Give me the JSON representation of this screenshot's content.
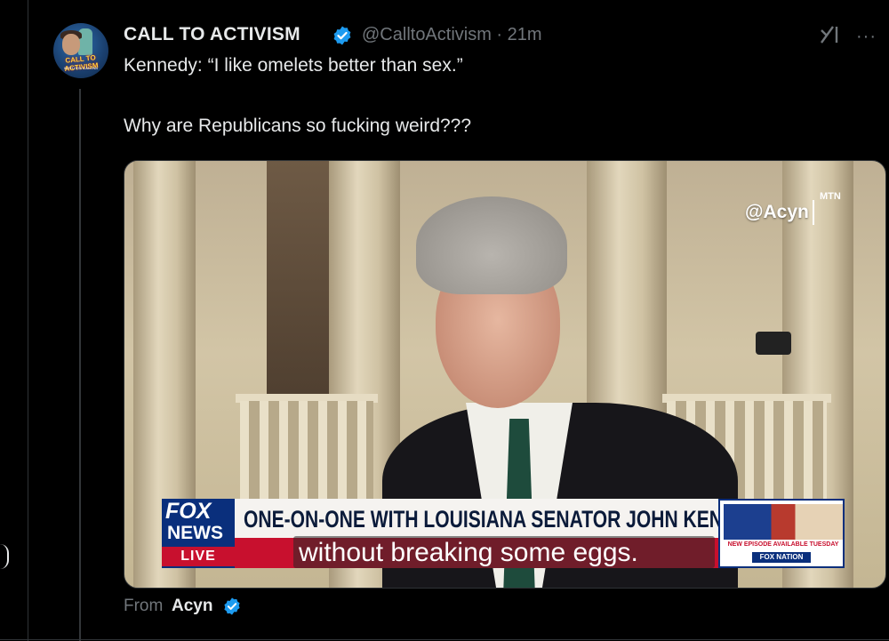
{
  "post": {
    "display_name": "CALL TO ACTIVISM",
    "handle_time": "@CalltoActivism · 21m",
    "text_line1": "Kennedy: “I like omelets better than sex.”",
    "text_line2": "Why are Republicans so fucking weird???",
    "avatar_text": "CALL TO ACTIVISM",
    "avatar_subtext": "WITH DON GALLINA",
    "more_label": "···"
  },
  "media": {
    "watermark": "@Acyn",
    "watermark_mtn": "MTN",
    "network_logo_top": "FOX",
    "network_logo_mid": "NEWS",
    "network_logo_live": "LIVE",
    "headline": "ONE-ON-ONE WITH LOUISIANA SENATOR JOHN KENNEDY",
    "subtitle": "without breaking some eggs.",
    "promo_text": "NEW EPISODE AVAILABLE TUESDAY",
    "promo_network": "FOX NATION"
  },
  "attribution": {
    "from_label": "From",
    "from_name": "Acyn"
  },
  "colors": {
    "background": "#000000",
    "verified": "#1d9bf0",
    "muted": "#71767b",
    "text": "#e7e9ea"
  },
  "icons": {
    "verified": "verified-badge-icon",
    "grok": "grok-icon",
    "more": "more-icon"
  }
}
